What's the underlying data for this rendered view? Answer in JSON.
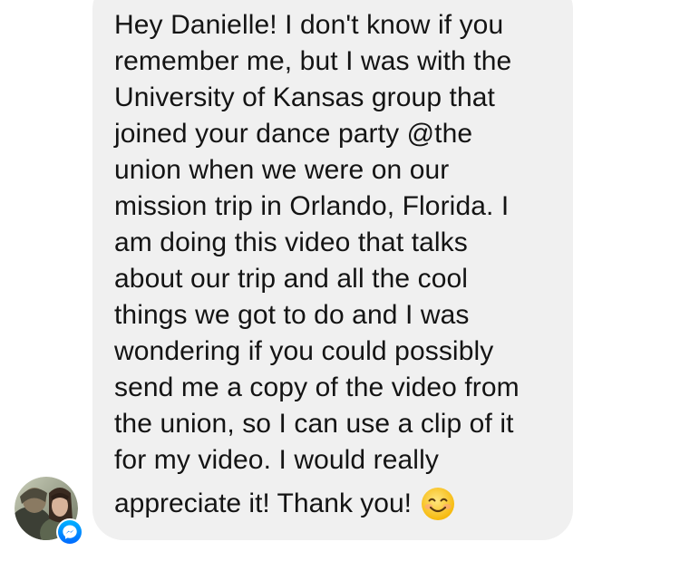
{
  "message": {
    "body_lines": "Hey Danielle! I don't know if you\nremember me, but I was with the\nUniversity of Kansas group that\njoined your dance party @the\nunion when we were on our\nmission trip in Orlando, Florida. I\nam doing this video that talks\nabout our trip and all the cool\nthings we got to do and I was\nwondering if you could possibly\nsend me a copy of the video from\nthe union, so I can use a clip of it\nfor my video. I would really",
    "last_line": "appreciate it! Thank you!",
    "emoji": "smiling-face-with-smiling-eyes"
  },
  "sender": {
    "avatar_icon": "avatar-photo",
    "badge_icon": "messenger-icon"
  },
  "colors": {
    "bubble": "#f0f0f0",
    "text": "#141414",
    "messenger_gradient_start": "#00b2ff",
    "messenger_gradient_end": "#006aff",
    "emoji_yellow": "#ffcc4d"
  }
}
